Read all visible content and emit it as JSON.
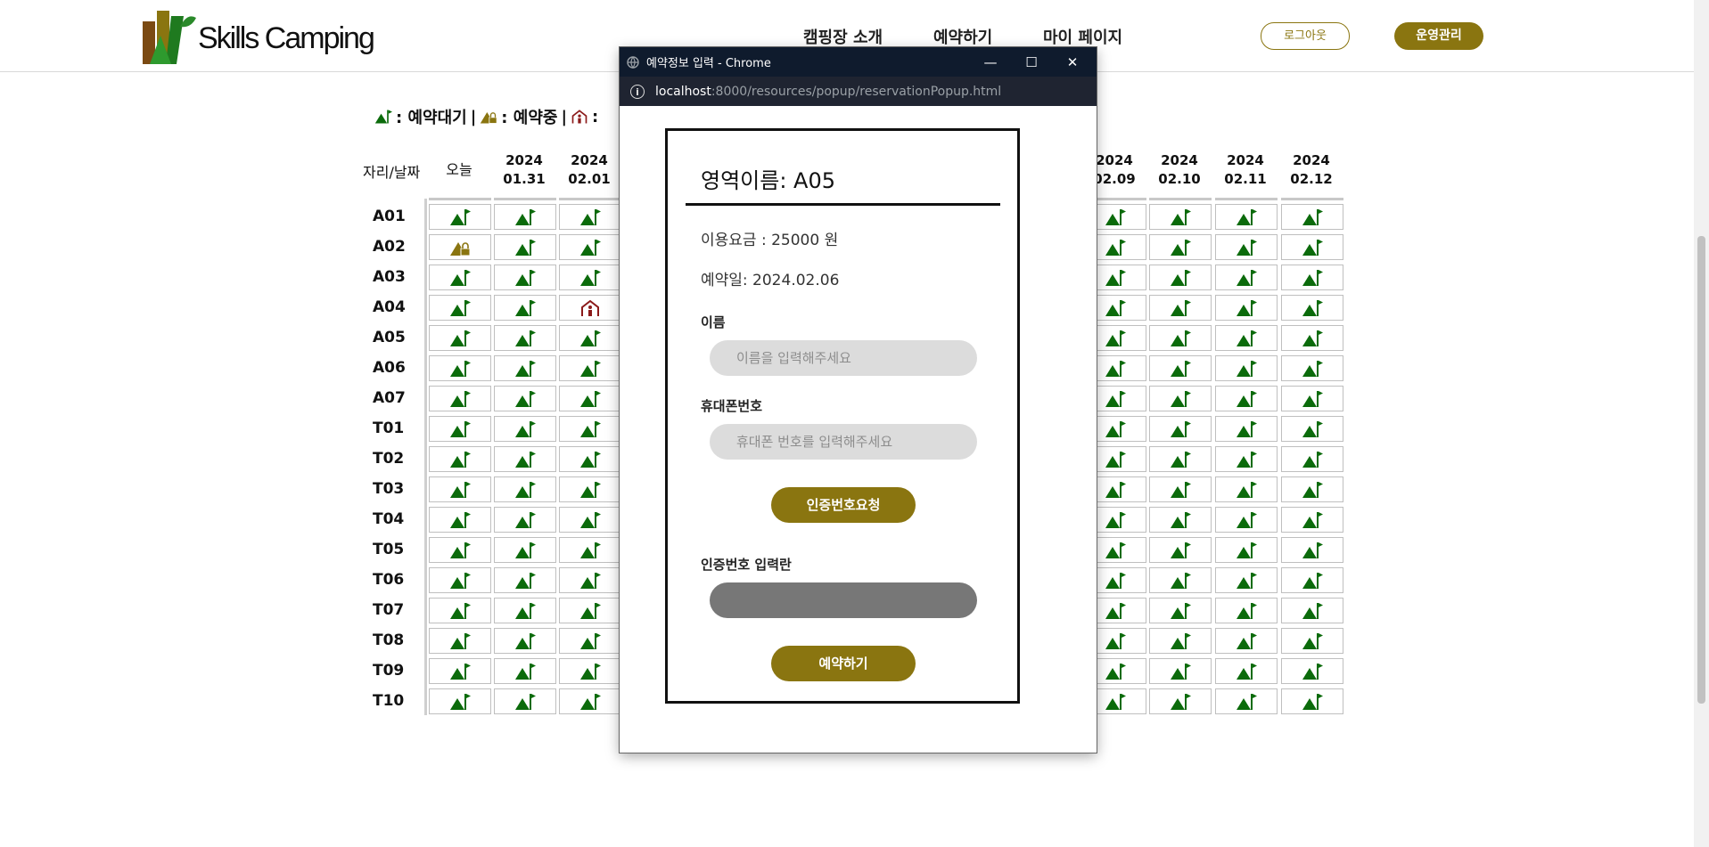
{
  "header": {
    "logo_text": "Skills Camping",
    "nav": [
      "캠핑장 소개",
      "예약하기",
      "마이 페이지"
    ],
    "logout_label": "로그아웃",
    "admin_label": "운영관리"
  },
  "legend": {
    "available": ": 예약대기",
    "separator": "|",
    "pending": ": 예약중",
    "done": ":"
  },
  "table": {
    "corner_label": "자리/날짜",
    "columns": [
      {
        "year": "",
        "date": "오늘"
      },
      {
        "year": "2024",
        "date": "01.31"
      },
      {
        "year": "2024",
        "date": "02.01"
      },
      {
        "year": "2024",
        "date": "02.09"
      },
      {
        "year": "2024",
        "date": "02.10"
      },
      {
        "year": "2024",
        "date": "02.11"
      },
      {
        "year": "2024",
        "date": "02.12"
      }
    ],
    "rows": [
      {
        "site": "A01",
        "status": [
          "available",
          "available",
          "available",
          "available",
          "available",
          "available",
          "available"
        ]
      },
      {
        "site": "A02",
        "status": [
          "pending",
          "available",
          "available",
          "available",
          "available",
          "available",
          "available"
        ]
      },
      {
        "site": "A03",
        "status": [
          "available",
          "available",
          "available",
          "available",
          "available",
          "available",
          "available"
        ]
      },
      {
        "site": "A04",
        "status": [
          "available",
          "available",
          "done",
          "available",
          "available",
          "available",
          "available"
        ]
      },
      {
        "site": "A05",
        "status": [
          "available",
          "available",
          "available",
          "available",
          "available",
          "available",
          "available"
        ]
      },
      {
        "site": "A06",
        "status": [
          "available",
          "available",
          "available",
          "available",
          "available",
          "available",
          "available"
        ]
      },
      {
        "site": "A07",
        "status": [
          "available",
          "available",
          "available",
          "available",
          "available",
          "available",
          "available"
        ]
      },
      {
        "site": "T01",
        "status": [
          "available",
          "available",
          "available",
          "available",
          "available",
          "available",
          "available"
        ]
      },
      {
        "site": "T02",
        "status": [
          "available",
          "available",
          "available",
          "available",
          "available",
          "available",
          "available"
        ]
      },
      {
        "site": "T03",
        "status": [
          "available",
          "available",
          "available",
          "available",
          "available",
          "available",
          "available"
        ]
      },
      {
        "site": "T04",
        "status": [
          "available",
          "available",
          "available",
          "available",
          "available",
          "available",
          "available"
        ]
      },
      {
        "site": "T05",
        "status": [
          "available",
          "available",
          "available",
          "available",
          "available",
          "available",
          "available"
        ]
      },
      {
        "site": "T06",
        "status": [
          "available",
          "available",
          "available",
          "available",
          "available",
          "available",
          "available"
        ]
      },
      {
        "site": "T07",
        "status": [
          "available",
          "available",
          "available",
          "available",
          "available",
          "available",
          "available"
        ]
      },
      {
        "site": "T08",
        "status": [
          "available",
          "available",
          "available",
          "available",
          "available",
          "available",
          "available"
        ]
      },
      {
        "site": "T09",
        "status": [
          "available",
          "available",
          "available",
          "available",
          "available",
          "available",
          "available"
        ]
      },
      {
        "site": "T10",
        "status": [
          "available",
          "available",
          "available",
          "available",
          "available",
          "available",
          "available"
        ]
      }
    ],
    "status_icons": {
      "available": "tent-flag-icon",
      "pending": "tent-lock-icon",
      "done": "tent-person-icon"
    },
    "colors": {
      "available": "#0b6b0b",
      "pending": "#8a7510",
      "done": "#8b1a1a"
    }
  },
  "popup": {
    "window_title": "예약정보 입력 - Chrome",
    "url_host": "localhost",
    "url_rest": ":8000/resources/popup/reservationPopup.html",
    "area_title": "영역이름: A05",
    "fee": "이용요금 : 25000 원",
    "reserve_date": "예약일: 2024.02.06",
    "name_label": "이름",
    "name_placeholder": "이름을 입력해주세요",
    "phone_label": "휴대폰번호",
    "phone_placeholder": "휴대폰 번호를 입력해주세요",
    "request_code_label": "인증번호요청",
    "code_label": "인증번호 입력란",
    "code_placeholder": "",
    "submit_label": "예약하기"
  },
  "theme": {
    "accent": "#8a7510",
    "titlebar": "#0f1b2d"
  }
}
